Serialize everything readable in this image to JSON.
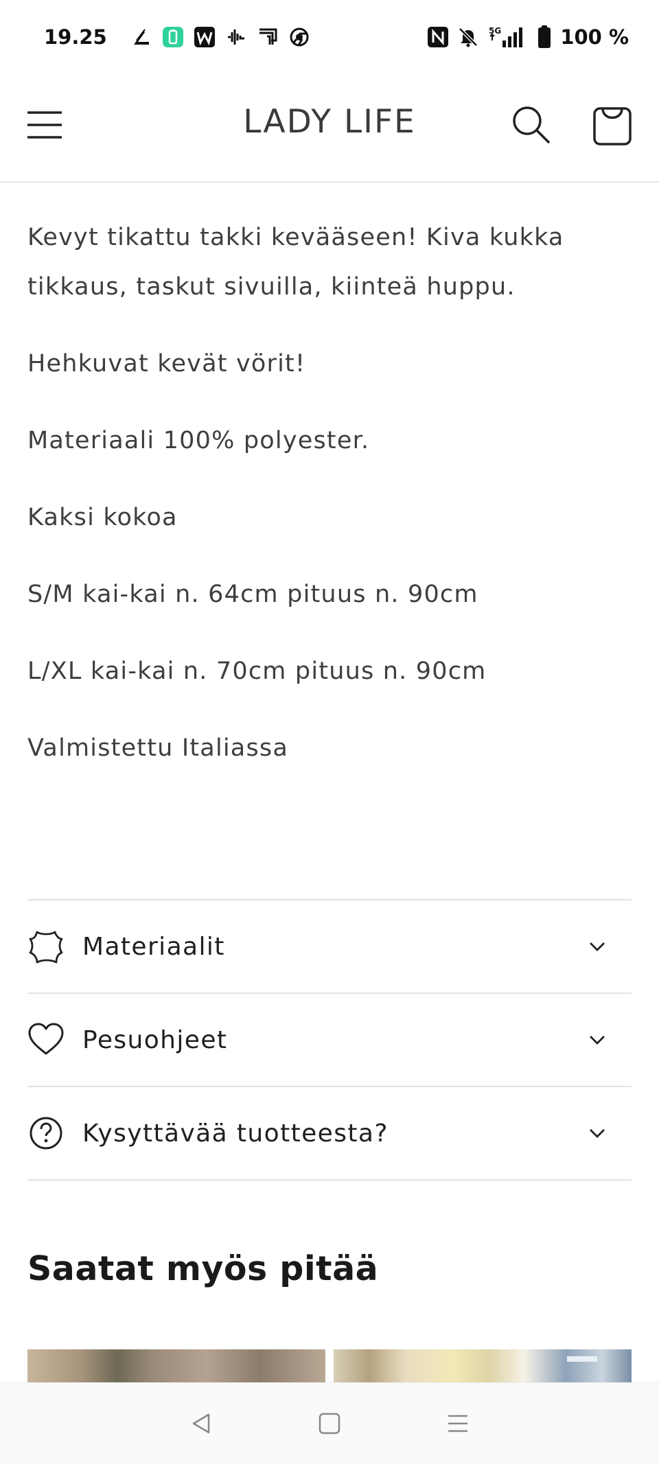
{
  "status_bar": {
    "time": "19.25",
    "battery_text": "100 %",
    "network": "5G",
    "left_icons": [
      "signal-app-icon",
      "battery-saver-icon",
      "w-app-icon",
      "audio-icon",
      "cast-icon",
      "chrome-icon"
    ],
    "right_icons": [
      "nfc-icon",
      "mute-icon",
      "cellular-signal-icon",
      "battery-icon"
    ]
  },
  "header": {
    "brand": "LADY LIFE",
    "menu_icon": "hamburger-icon",
    "search_icon": "search-icon",
    "cart_icon": "cart-icon"
  },
  "description": {
    "paragraphs": [
      "Kevyt tikattu takki kevääseen!  Kiva kukka tikkaus,  taskut sivuilla, kiinteä huppu.",
      "Hehkuvat kevät vörit!",
      "Materiaali  100% polyester.",
      "Kaksi  kokoa",
      "S/M  kai-kai  n. 64cm  pituus n. 90cm",
      "L/XL  kai-kai  n. 70cm  pituus  n. 90cm",
      "Valmistettu Italiassa"
    ]
  },
  "accordion": {
    "items": [
      {
        "label": "Materiaalit",
        "icon": "leather-icon"
      },
      {
        "label": "Pesuohjeet",
        "icon": "heart-icon"
      },
      {
        "label": "Kysyttävää tuotteesta?",
        "icon": "question-circle-icon"
      }
    ]
  },
  "related": {
    "title": "Saatat myös pitää"
  },
  "nav_bar": {
    "icons": [
      "back-icon",
      "home-icon",
      "recents-icon"
    ]
  },
  "colors": {
    "text": "#3e3e3e",
    "divider": "#e3e3e3",
    "background": "#ffffff"
  }
}
